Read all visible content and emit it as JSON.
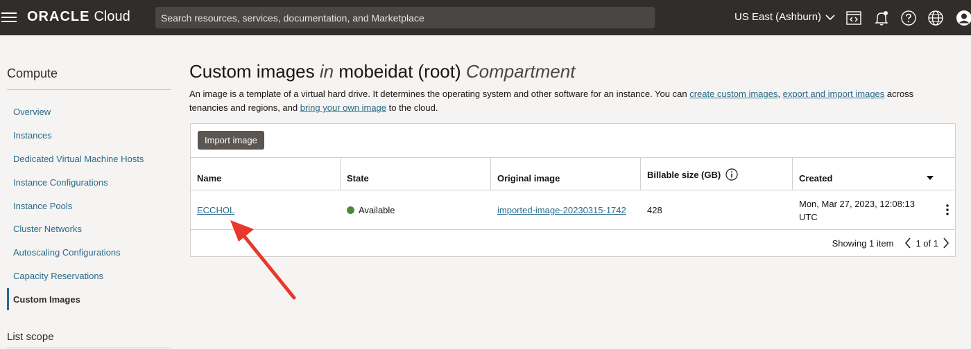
{
  "header": {
    "brand": "ORACLE",
    "product": "Cloud",
    "search_placeholder": "Search resources, services, documentation, and Marketplace",
    "region": "US East (Ashburn)",
    "icons": [
      "menu-icon",
      "code-editor-icon",
      "bell-icon",
      "help-icon",
      "globe-icon",
      "user-icon"
    ]
  },
  "sidebar": {
    "title": "Compute",
    "items": [
      {
        "label": "Overview"
      },
      {
        "label": "Instances"
      },
      {
        "label": "Dedicated Virtual Machine Hosts"
      },
      {
        "label": "Instance Configurations"
      },
      {
        "label": "Instance Pools"
      },
      {
        "label": "Cluster Networks"
      },
      {
        "label": "Autoscaling Configurations"
      },
      {
        "label": "Capacity Reservations"
      },
      {
        "label": "Custom Images",
        "active": true
      }
    ],
    "list_scope": "List scope"
  },
  "main": {
    "title_part1": "Custom images",
    "title_in": "in",
    "title_part2": "mobeidat (root)",
    "title_part3": "Compartment",
    "intro": {
      "t1": "An image is a template of a virtual hard drive. It determines the operating system and other software for an instance. You can ",
      "link1": "create custom images",
      "t2": ", ",
      "link2": "export and import images",
      "t3": " across tenancies and regions, and ",
      "link3": "bring your own image",
      "t4": " to the cloud."
    },
    "import_button": "Import image",
    "columns": [
      "Name",
      "State",
      "Original image",
      "Billable size (GB)",
      "Created"
    ],
    "rows": [
      {
        "name": "ECCHOL",
        "state": "Available",
        "original_image": "imported-image-20230315-1742",
        "billable_size": "428",
        "created": "Mon, Mar 27, 2023, 12:08:13 UTC"
      }
    ],
    "pager": {
      "showing": "Showing 1 item",
      "page": "1 of 1"
    }
  },
  "colors": {
    "topbar": "#312d2a",
    "link": "#2a6a8a",
    "available": "#4e8a2f",
    "annotation_arrow": "#e8382c"
  }
}
